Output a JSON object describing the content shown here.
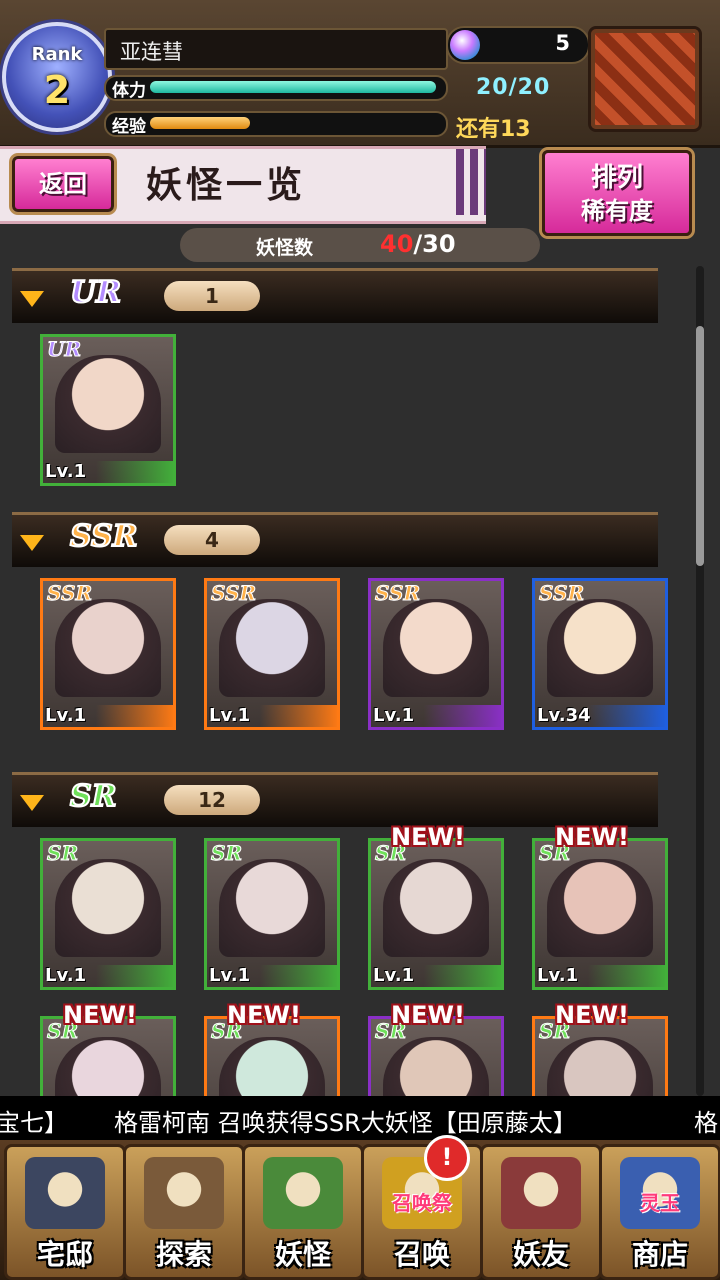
{
  "player": {
    "rank_label": "Rank",
    "rank": "2",
    "name": "亚连彗",
    "gems": "5",
    "stamina_label": "体力",
    "stamina": "20/20",
    "stamina_fraction": 1.0,
    "exp_label": "经验",
    "exp_remaining": "还有13",
    "exp_fraction": 0.35
  },
  "header": {
    "back_label": "返回",
    "title": "妖怪一览",
    "sort_label_1": "排列",
    "sort_label_2": "稀有度",
    "count_label": "妖怪数",
    "count_current": "40",
    "count_max": "/30"
  },
  "sections": [
    {
      "rarity": "UR",
      "count": "1",
      "color": "#b38cff",
      "cards": [
        {
          "rarity": "UR",
          "level": "Lv.1",
          "frame": "#42b03a",
          "new": false
        }
      ]
    },
    {
      "rarity": "SSR",
      "count": "4",
      "color": "#ffb24a",
      "cards": [
        {
          "rarity": "SSR",
          "level": "Lv.1",
          "frame": "#ff7a14",
          "new": false
        },
        {
          "rarity": "SSR",
          "level": "Lv.1",
          "frame": "#ff7a14",
          "new": false
        },
        {
          "rarity": "SSR",
          "level": "Lv.1",
          "frame": "#8a2fc7",
          "new": false
        },
        {
          "rarity": "SSR",
          "level": "Lv.34",
          "frame": "#1f5fe0",
          "new": false
        }
      ]
    },
    {
      "rarity": "SR",
      "count": "12",
      "color": "#6fe05a",
      "cards": [
        {
          "rarity": "SR",
          "level": "Lv.1",
          "frame": "#42b03a",
          "new": false
        },
        {
          "rarity": "SR",
          "level": "Lv.1",
          "frame": "#42b03a",
          "new": false
        },
        {
          "rarity": "SR",
          "level": "Lv.1",
          "frame": "#42b03a",
          "new": true
        },
        {
          "rarity": "SR",
          "level": "Lv.1",
          "frame": "#42b03a",
          "new": true
        },
        {
          "rarity": "SR",
          "level": "",
          "frame": "#42b03a",
          "new": true
        },
        {
          "rarity": "SR",
          "level": "",
          "frame": "#ff7a14",
          "new": true
        },
        {
          "rarity": "SR",
          "level": "",
          "frame": "#8a2fc7",
          "new": true
        },
        {
          "rarity": "SR",
          "level": "",
          "frame": "#ff7a14",
          "new": true
        }
      ]
    }
  ],
  "new_label": "NEW!",
  "ticker": {
    "left": "宝七】",
    "main": "格雷柯南 召唤获得SSR大妖怪【田原藤太】",
    "right": "格"
  },
  "nav": [
    {
      "label": "宅邸",
      "icon": "mansion-icon"
    },
    {
      "label": "探索",
      "icon": "magnifier-icon"
    },
    {
      "label": "妖怪",
      "icon": "yokai-scroll-icon"
    },
    {
      "label": "召唤",
      "icon": "summon-star-icon",
      "badge": "!",
      "sub": "召唤祭"
    },
    {
      "label": "妖友",
      "icon": "friend-icon"
    },
    {
      "label": "商店",
      "icon": "shop-orb-icon",
      "sub": "灵玉"
    }
  ]
}
